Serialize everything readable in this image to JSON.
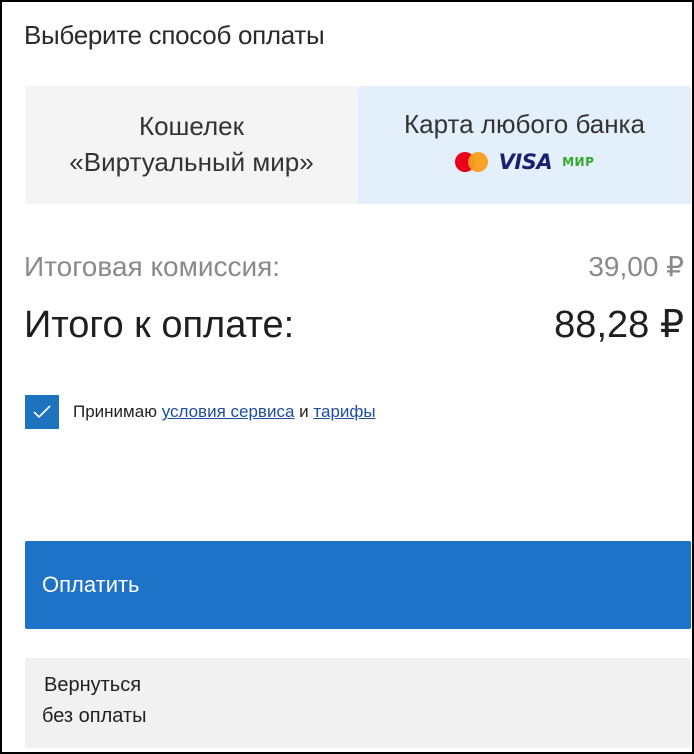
{
  "header": {
    "title": "Выберите способ оплаты"
  },
  "tabs": {
    "wallet": {
      "line1": "Кошелек",
      "line2": "«Виртуальный мир»"
    },
    "card": {
      "label": "Карта любого банка",
      "logos": [
        "mastercard-logo",
        "visa-logo",
        "mir-logo"
      ],
      "visa_text": "VISA",
      "mir_text": "МИР"
    }
  },
  "summary": {
    "fee_label": "Итоговая комиссия:",
    "fee_value": "39,00 ₽",
    "total_label": "Итого к оплате:",
    "total_value": "88,28 ₽"
  },
  "agreement": {
    "checked": true,
    "prefix": "Принимаю",
    "terms_link": "условия сервиса",
    "and": "и",
    "tariffs_link": "тарифы"
  },
  "actions": {
    "pay_label": "Оплатить",
    "back_line1": "Вернуться",
    "back_line2": "без оплаты"
  },
  "colors": {
    "accent": "#1e73c8",
    "selected_tab_bg": "#e3f0fb",
    "link": "#1e4fa3"
  }
}
